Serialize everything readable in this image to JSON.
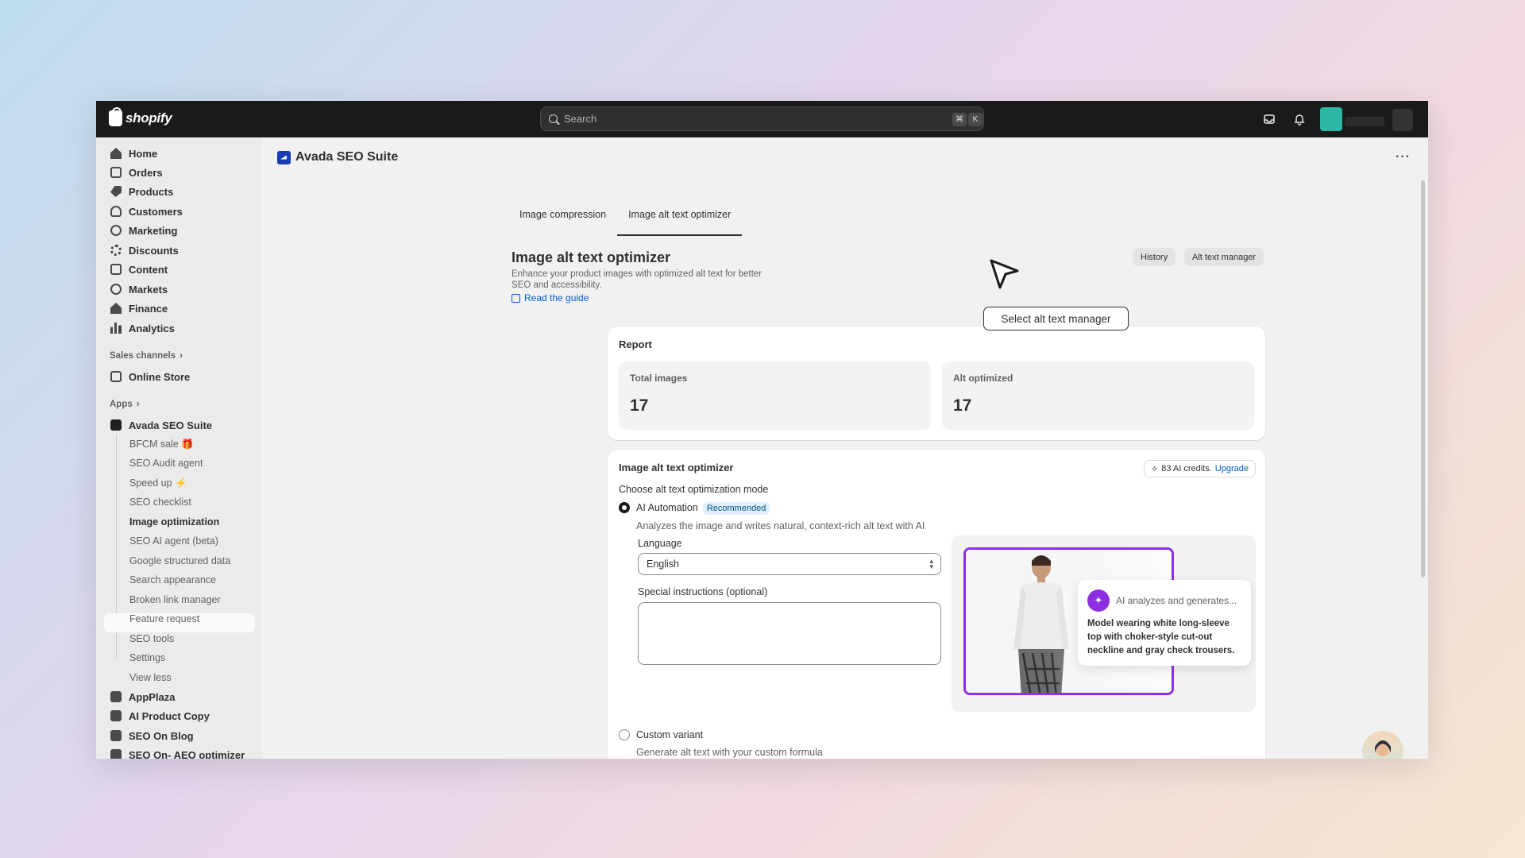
{
  "topbar": {
    "logo_text": "shopify",
    "search_placeholder": "Search",
    "shortcut_cmd": "⌘",
    "shortcut_key": "K"
  },
  "sidebar": {
    "main_items": [
      {
        "label": "Home",
        "icon": "home-icon"
      },
      {
        "label": "Orders",
        "icon": "inbox-icon"
      },
      {
        "label": "Products",
        "icon": "tag-icon"
      },
      {
        "label": "Customers",
        "icon": "person-icon"
      },
      {
        "label": "Marketing",
        "icon": "target-icon"
      },
      {
        "label": "Discounts",
        "icon": "discount-icon"
      },
      {
        "label": "Content",
        "icon": "content-icon"
      },
      {
        "label": "Markets",
        "icon": "globe-icon"
      },
      {
        "label": "Finance",
        "icon": "bank-icon"
      },
      {
        "label": "Analytics",
        "icon": "chart-icon"
      }
    ],
    "sales_channels_label": "Sales channels",
    "online_store_label": "Online Store",
    "apps_label": "Apps",
    "app_name": "Avada SEO Suite",
    "app_sub_items": [
      "BFCM sale 🎁",
      "SEO Audit agent",
      "Speed up ⚡",
      "SEO checklist",
      "Image optimization",
      "SEO AI agent (beta)",
      "Google structured data",
      "Search appearance",
      "Broken link manager",
      "Feature request",
      "SEO tools",
      "Settings",
      "View less"
    ],
    "other_apps": [
      "AppPlaza",
      "AI Product Copy",
      "SEO On Blog",
      "SEO On- AEO optimizer"
    ]
  },
  "main": {
    "app_title": "Avada SEO Suite",
    "more_label": "···",
    "tabs": [
      "Image compression",
      "Image alt text optimizer"
    ],
    "active_tab": "Image alt text optimizer",
    "heading": "Image alt text optimizer",
    "description": "Enhance your product images with optimized alt text for better SEO and accessibility.",
    "guide_link": "Read the guide",
    "history_button": "History",
    "manager_button": "Alt text manager",
    "tooltip": "Select alt text manager"
  },
  "report": {
    "title": "Report",
    "total_label": "Total images",
    "total_value": "17",
    "optimized_label": "Alt optimized",
    "optimized_value": "17"
  },
  "optimizer": {
    "title": "Image alt text optimizer",
    "credits_text": "83 AI credits.",
    "upgrade_link": "Upgrade",
    "mode_label": "Choose alt text optimization mode",
    "ai_option_label": "AI Automation",
    "ai_badge": "Recommended",
    "ai_option_desc": "Analyzes the image and writes natural, context-rich alt text with AI",
    "language_label": "Language",
    "language_value": "English",
    "instructions_label": "Special instructions (optional)",
    "instructions_value": "",
    "preview_header": "AI analyzes and generates...",
    "preview_text": "Model wearing white long-sleeve top with choker-style cut-out neckline and gray check trousers.",
    "custom_option_label": "Custom variant",
    "custom_option_desc": "Generate alt text with your custom formula"
  },
  "colors": {
    "accent_purple": "#8b2fe0",
    "link_blue": "#005bd3",
    "topbar_bg": "#1a1a1a"
  }
}
